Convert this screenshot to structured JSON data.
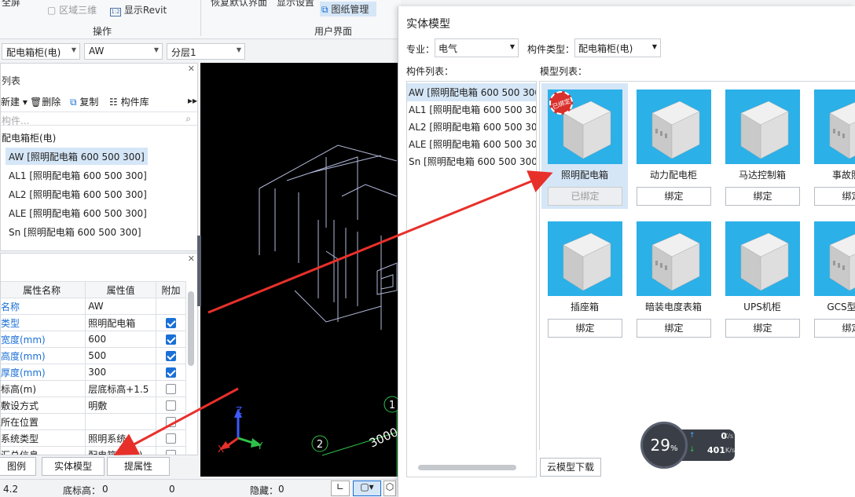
{
  "ribbon": {
    "btn_full": "全屏",
    "btn_region3d": "区域三维",
    "btn_showrevit": "显示Revit",
    "btn_restore_ui": "恢复默认界面",
    "btn_display_settings": "显示设置",
    "btn_drawing_mgmt": "图纸管理",
    "group_operation": "操作",
    "group_user_ui": "用户界面"
  },
  "toolbar": {
    "dd_type": "配电箱柜(电)",
    "dd_name": "AW",
    "dd_layer": "分层1"
  },
  "component_panel": {
    "title": "列表",
    "new_label": "新建",
    "delete_label": "删除",
    "copy_label": "复制",
    "library_label": "构件库",
    "search_placeholder": "构件...",
    "group_label": "配电箱柜(电)",
    "items": [
      "AW [照明配电箱 600 500 300]",
      "AL1 [照明配电箱 600 500 300]",
      "AL2 [照明配电箱 600 500 300]",
      "ALE [照明配电箱 600 500 300]",
      "Sn [照明配电箱 600 500 300]"
    ]
  },
  "properties": {
    "headers": [
      "属性名称",
      "属性值",
      "附加"
    ],
    "rows": [
      {
        "name": "名称",
        "value": "AW",
        "checkbox": "none",
        "blue": true
      },
      {
        "name": "类型",
        "value": "照明配电箱",
        "checkbox": "on",
        "blue": true
      },
      {
        "name": "宽度(mm)",
        "value": "600",
        "checkbox": "on",
        "blue": true
      },
      {
        "name": "高度(mm)",
        "value": "500",
        "checkbox": "on",
        "blue": true
      },
      {
        "name": "厚度(mm)",
        "value": "300",
        "checkbox": "on",
        "blue": true
      },
      {
        "name": "标高(m)",
        "value": "层底标高+1.5",
        "checkbox": "off",
        "blue": false
      },
      {
        "name": "敷设方式",
        "value": "明敷",
        "checkbox": "off",
        "blue": false
      },
      {
        "name": "所在位置",
        "value": "",
        "checkbox": "off",
        "blue": false
      },
      {
        "name": "系统类型",
        "value": "照明系统",
        "checkbox": "off",
        "blue": false
      },
      {
        "name": "汇总信息",
        "value": "配电箱柜(电)",
        "checkbox": "off",
        "blue": false
      }
    ],
    "btn_legend": "图例",
    "btn_solid_model": "实体模型",
    "btn_extract": "提属性"
  },
  "viewport": {
    "axis_z": "Z",
    "axis_x": "X",
    "axis_y": "Y",
    "grid_label_1": "1",
    "grid_label_2": "2",
    "dimension": "3000"
  },
  "status": {
    "left_value": "4.2",
    "floor_label": "底标高：",
    "floor_value": "0",
    "mid_value": "0",
    "hidden_label": "隐藏：",
    "hidden_value": "0"
  },
  "dialog": {
    "title": "实体模型",
    "major_label": "专业：",
    "major_value": "电气",
    "type_label": "构件类型：",
    "type_value": "配电箱柜(电)",
    "comp_list_label": "构件列表：",
    "model_list_label": "模型列表：",
    "comp_items": [
      "AW [照明配电箱 600 500 300]",
      "AL1 [照明配电箱 600 500 300]",
      "AL2 [照明配电箱 600 500 300]",
      "ALE [照明配电箱 600 500 300]",
      "Sn [照明配电箱 600 500 300]"
    ],
    "models": [
      {
        "name": "照明配电箱",
        "btn": "已绑定",
        "bound": true,
        "stamp": "已绑定"
      },
      {
        "name": "动力配电柜",
        "btn": "绑定",
        "bound": false
      },
      {
        "name": "马达控制箱",
        "btn": "绑定",
        "bound": false
      },
      {
        "name": "事故照明",
        "btn": "绑定",
        "bound": false
      },
      {
        "name": "插座箱",
        "btn": "绑定",
        "bound": false
      },
      {
        "name": "暗装电度表箱",
        "btn": "绑定",
        "bound": false
      },
      {
        "name": "UPS机柜",
        "btn": "绑定",
        "bound": false
      },
      {
        "name": "GCS型低压",
        "btn": "绑定",
        "bound": false
      }
    ],
    "cloud_download": "云模型下载"
  },
  "speed_widget": {
    "percent": "29",
    "percent_sign": "%",
    "up_value": "0",
    "up_unit": "K/s",
    "down_value": "401",
    "down_unit": "K/s"
  },
  "colors": {
    "model_bg": "#2bb0e8",
    "selected_bg": "#d5e6f7",
    "accent": "#1a6fd6",
    "arrow": "#e8302a"
  }
}
